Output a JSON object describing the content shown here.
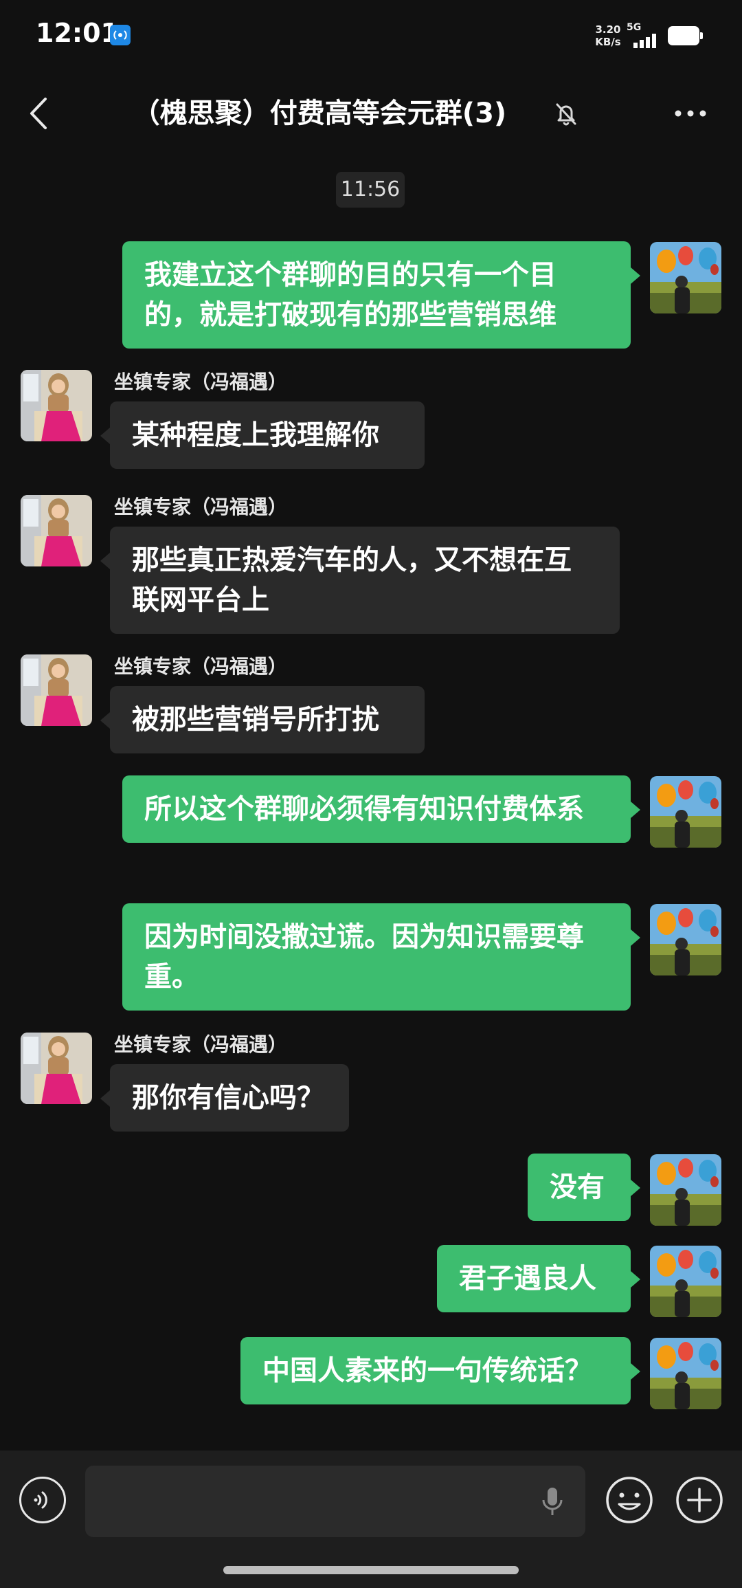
{
  "status_bar": {
    "time": "12:01",
    "net_speed_value": "3.20",
    "net_speed_unit": "KB/s",
    "network": "5G",
    "battery_color": "#ffffff"
  },
  "header": {
    "title": "（槐思聚）付费高等会元群(3)",
    "back_icon": "chevron-left-icon",
    "mute_icon": "bell-off-icon",
    "more_icon": "more-dots-icon"
  },
  "chat": {
    "timestamp": "11:56",
    "messages": [
      {
        "side": "right",
        "text": "我建立这个群聊的目的只有一个目的，就是打破现有的那些营销思维"
      },
      {
        "side": "left",
        "sender": "坐镇专家（冯福遇）",
        "text": "某种程度上我理解你"
      },
      {
        "side": "left",
        "sender": "坐镇专家（冯福遇）",
        "text": "那些真正热爱汽车的人，又不想在互联网平台上"
      },
      {
        "side": "left",
        "sender": "坐镇专家（冯福遇）",
        "text": "被那些营销号所打扰"
      },
      {
        "side": "right",
        "text": "所以这个群聊必须得有知识付费体系"
      },
      {
        "side": "right",
        "text": "因为时间没撒过谎。因为知识需要尊重。"
      },
      {
        "side": "left",
        "sender": "坐镇专家（冯福遇）",
        "text": "那你有信心吗？"
      },
      {
        "side": "right",
        "text": "没有"
      },
      {
        "side": "right",
        "text": "君子遇良人"
      },
      {
        "side": "right",
        "text": "中国人素来的一句传统话？"
      }
    ]
  },
  "input_bar": {
    "placeholder": "",
    "voice_icon": "voice-waves-icon",
    "mic_icon": "microphone-icon",
    "emoji_icon": "smiley-icon",
    "plus_icon": "plus-circle-icon"
  },
  "colors": {
    "background": "#111111",
    "outgoing_bubble": "#3dbd6f",
    "incoming_bubble": "#2a2a2a",
    "input_bar": "#1e1e1e"
  }
}
